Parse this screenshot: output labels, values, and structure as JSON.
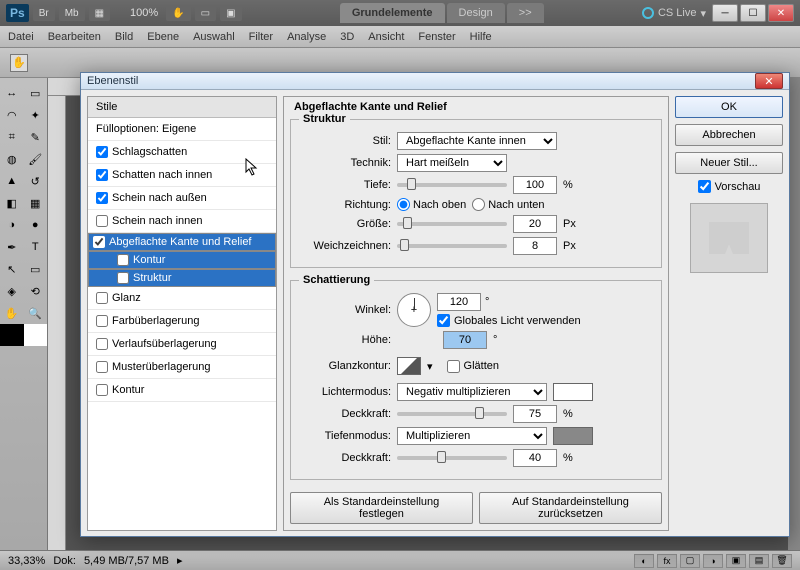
{
  "app": {
    "logo": "Ps",
    "br": "Br",
    "mb": "Mb",
    "zoom_app": "100%"
  },
  "workspace_tabs": {
    "grund": "Grundelemente",
    "design": "Design",
    "more": ">>"
  },
  "cslive": "CS Live",
  "menu": {
    "datei": "Datei",
    "bearbeiten": "Bearbeiten",
    "bild": "Bild",
    "ebene": "Ebene",
    "auswahl": "Auswahl",
    "filter": "Filter",
    "analyse": "Analyse",
    "dd": "3D",
    "ansicht": "Ansicht",
    "fenster": "Fenster",
    "hilfe": "Hilfe"
  },
  "status": {
    "zoom": "33,33%",
    "dok_lbl": "Dok:",
    "dok_val": "5,49 MB/7,57 MB"
  },
  "dialog": {
    "title": "Ebenenstil",
    "styles_hdr": "Stile",
    "fill_opts": "Fülloptionen: Eigene",
    "items": {
      "schlag": "Schlagschatten",
      "schatten_innen": "Schatten nach innen",
      "schein_aussen": "Schein nach außen",
      "schein_innen": "Schein nach innen",
      "bevel": "Abgeflachte Kante und Relief",
      "kontur": "Kontur",
      "struktur": "Struktur",
      "glanz": "Glanz",
      "farb": "Farbüberlagerung",
      "verlauf": "Verlaufsüberlagerung",
      "muster": "Musterüberlagerung",
      "kontur2": "Kontur"
    },
    "panel_title": "Abgeflachte Kante und Relief",
    "struktur_title": "Struktur",
    "schattierung_title": "Schattierung",
    "labels": {
      "stil": "Stil:",
      "technik": "Technik:",
      "tiefe": "Tiefe:",
      "richtung": "Richtung:",
      "groesse": "Größe:",
      "weich": "Weichzeichnen:",
      "winkel": "Winkel:",
      "hoehe": "Höhe:",
      "glanzkontur": "Glanzkontur:",
      "licht": "Lichtermodus:",
      "deck": "Deckkraft:",
      "tiefen": "Tiefenmodus:"
    },
    "values": {
      "stil": "Abgeflachte Kante innen",
      "technik": "Hart meißeln",
      "tiefe": "100",
      "groesse": "20",
      "weich": "8",
      "nach_oben": "Nach oben",
      "nach_unten": "Nach unten",
      "winkel": "120",
      "hoehe": "70",
      "global": "Globales Licht verwenden",
      "glaetten": "Glätten",
      "licht": "Negativ multiplizieren",
      "deck1": "75",
      "tiefen": "Multiplizieren",
      "deck2": "40",
      "pct": "%",
      "px": "Px",
      "deg": "°"
    },
    "btns": {
      "std": "Als Standardeinstellung festlegen",
      "reset": "Auf Standardeinstellung zurücksetzen"
    },
    "right": {
      "ok": "OK",
      "cancel": "Abbrechen",
      "new": "Neuer Stil...",
      "preview": "Vorschau"
    }
  }
}
